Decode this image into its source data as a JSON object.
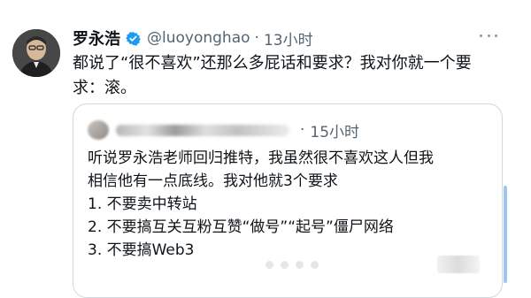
{
  "tweet": {
    "author_name": "罗永浩",
    "verified_icon": "verified-badge-icon",
    "handle": "@luoyonghao",
    "separator": "·",
    "time": "13小时",
    "text": "都说了“很不喜欢”还那么多屁话和要求？我对你就一个要\n求：滚。",
    "more_icon": "more-options-icon"
  },
  "quoted_tweet": {
    "separator": "·",
    "time": "15小时",
    "text": "听说罗永浩老师回归推特，我虽然很不喜欢这人但我\n相信他有一点底线。我对他就3个要求\n1. 不要卖中转站\n2. 不要搞互关互粉互赞“做号”“起号”僵尸网络\n3. 不要搞Web3"
  },
  "colors": {
    "text_primary": "#0f1419",
    "text_secondary": "#536471",
    "verified_blue": "#1d9bf0",
    "border": "#cfd9de"
  }
}
